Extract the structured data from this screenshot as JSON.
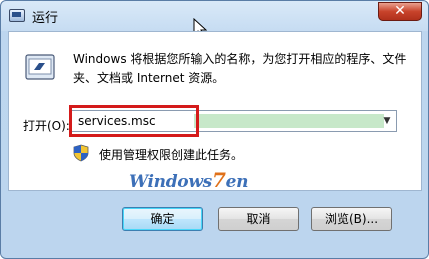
{
  "window": {
    "title": "运行",
    "close_glyph": "✕"
  },
  "content": {
    "description": "Windows 将根据您所输入的名称，为您打开相应的程序、文件夹、文档或 Internet 资源。",
    "open_label": "打开(O):",
    "open_value": "services.msc",
    "admin_note": "使用管理权限创建此任务。",
    "watermark_text": "Windows",
    "watermark_seven": "7",
    "watermark_suffix": "en"
  },
  "buttons": {
    "ok_label": "确定",
    "cancel_label": "取消",
    "browse_label": "浏览(B)..."
  },
  "icons": {
    "title": "run-icon",
    "close": "close-icon",
    "dropdown": "chevron-down-icon",
    "shield": "uac-shield-icon",
    "cursor": "mouse-pointer-icon"
  },
  "colors": {
    "highlight_border": "#d41a1a",
    "selection": "#c7e8c9",
    "window_frame": "#bdd6ef"
  }
}
